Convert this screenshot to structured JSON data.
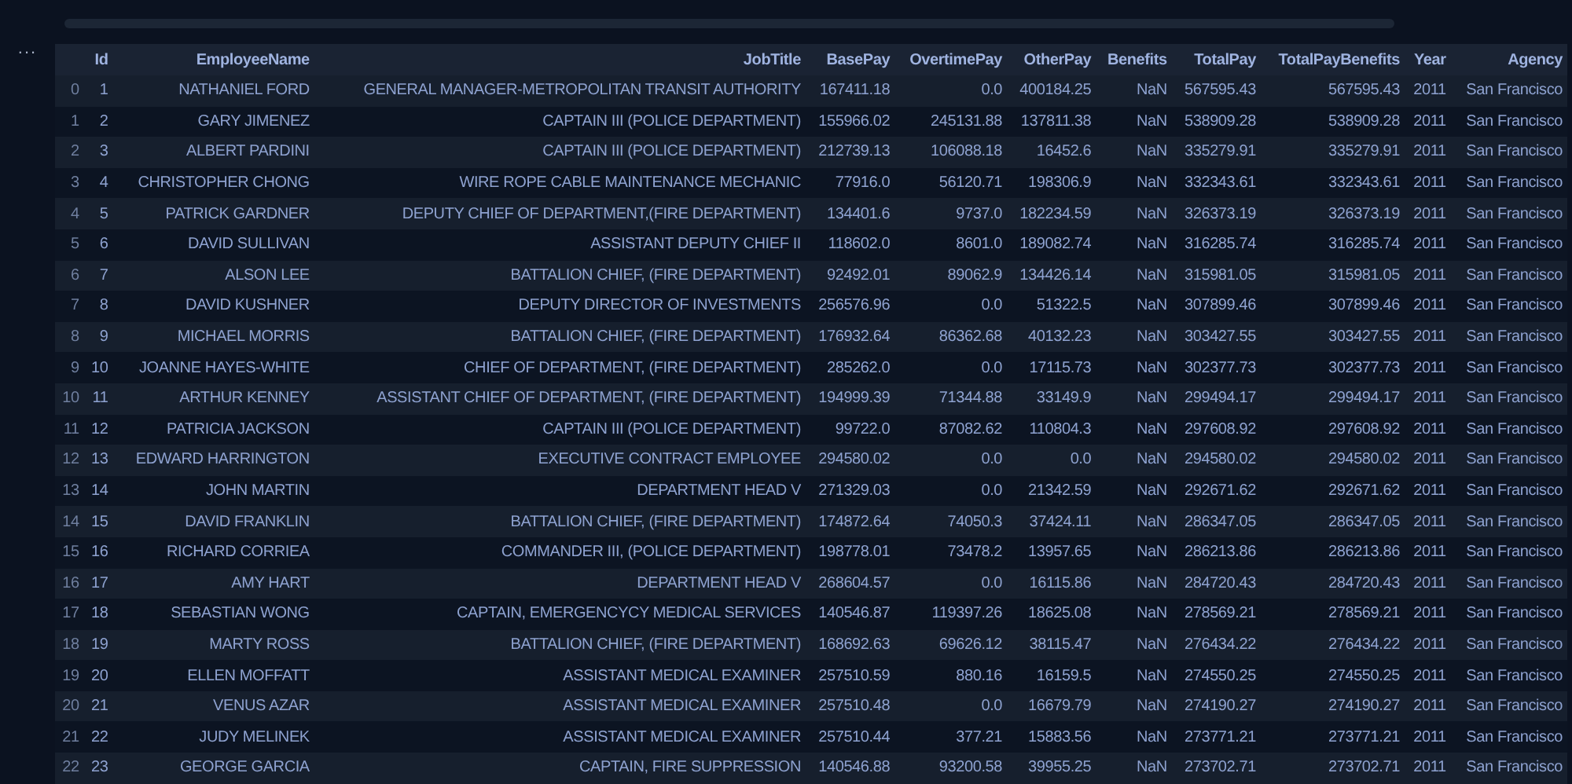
{
  "output_menu": "...",
  "table": {
    "columns": [
      "",
      "Id",
      "EmployeeName",
      "JobTitle",
      "BasePay",
      "OvertimePay",
      "OtherPay",
      "Benefits",
      "TotalPay",
      "TotalPayBenefits",
      "Year",
      "Agency"
    ],
    "rows": [
      [
        "0",
        "1",
        "NATHANIEL FORD",
        "GENERAL MANAGER-METROPOLITAN TRANSIT AUTHORITY",
        "167411.18",
        "0.0",
        "400184.25",
        "NaN",
        "567595.43",
        "567595.43",
        "2011",
        "San Francisco"
      ],
      [
        "1",
        "2",
        "GARY JIMENEZ",
        "CAPTAIN III (POLICE DEPARTMENT)",
        "155966.02",
        "245131.88",
        "137811.38",
        "NaN",
        "538909.28",
        "538909.28",
        "2011",
        "San Francisco"
      ],
      [
        "2",
        "3",
        "ALBERT PARDINI",
        "CAPTAIN III (POLICE DEPARTMENT)",
        "212739.13",
        "106088.18",
        "16452.6",
        "NaN",
        "335279.91",
        "335279.91",
        "2011",
        "San Francisco"
      ],
      [
        "3",
        "4",
        "CHRISTOPHER CHONG",
        "WIRE ROPE CABLE MAINTENANCE MECHANIC",
        "77916.0",
        "56120.71",
        "198306.9",
        "NaN",
        "332343.61",
        "332343.61",
        "2011",
        "San Francisco"
      ],
      [
        "4",
        "5",
        "PATRICK GARDNER",
        "DEPUTY CHIEF OF DEPARTMENT,(FIRE DEPARTMENT)",
        "134401.6",
        "9737.0",
        "182234.59",
        "NaN",
        "326373.19",
        "326373.19",
        "2011",
        "San Francisco"
      ],
      [
        "5",
        "6",
        "DAVID SULLIVAN",
        "ASSISTANT DEPUTY CHIEF II",
        "118602.0",
        "8601.0",
        "189082.74",
        "NaN",
        "316285.74",
        "316285.74",
        "2011",
        "San Francisco"
      ],
      [
        "6",
        "7",
        "ALSON LEE",
        "BATTALION CHIEF, (FIRE DEPARTMENT)",
        "92492.01",
        "89062.9",
        "134426.14",
        "NaN",
        "315981.05",
        "315981.05",
        "2011",
        "San Francisco"
      ],
      [
        "7",
        "8",
        "DAVID KUSHNER",
        "DEPUTY DIRECTOR OF INVESTMENTS",
        "256576.96",
        "0.0",
        "51322.5",
        "NaN",
        "307899.46",
        "307899.46",
        "2011",
        "San Francisco"
      ],
      [
        "8",
        "9",
        "MICHAEL MORRIS",
        "BATTALION CHIEF, (FIRE DEPARTMENT)",
        "176932.64",
        "86362.68",
        "40132.23",
        "NaN",
        "303427.55",
        "303427.55",
        "2011",
        "San Francisco"
      ],
      [
        "9",
        "10",
        "JOANNE HAYES-WHITE",
        "CHIEF OF DEPARTMENT, (FIRE DEPARTMENT)",
        "285262.0",
        "0.0",
        "17115.73",
        "NaN",
        "302377.73",
        "302377.73",
        "2011",
        "San Francisco"
      ],
      [
        "10",
        "11",
        "ARTHUR KENNEY",
        "ASSISTANT CHIEF OF DEPARTMENT, (FIRE DEPARTMENT)",
        "194999.39",
        "71344.88",
        "33149.9",
        "NaN",
        "299494.17",
        "299494.17",
        "2011",
        "San Francisco"
      ],
      [
        "11",
        "12",
        "PATRICIA JACKSON",
        "CAPTAIN III (POLICE DEPARTMENT)",
        "99722.0",
        "87082.62",
        "110804.3",
        "NaN",
        "297608.92",
        "297608.92",
        "2011",
        "San Francisco"
      ],
      [
        "12",
        "13",
        "EDWARD HARRINGTON",
        "EXECUTIVE CONTRACT EMPLOYEE",
        "294580.02",
        "0.0",
        "0.0",
        "NaN",
        "294580.02",
        "294580.02",
        "2011",
        "San Francisco"
      ],
      [
        "13",
        "14",
        "JOHN MARTIN",
        "DEPARTMENT HEAD V",
        "271329.03",
        "0.0",
        "21342.59",
        "NaN",
        "292671.62",
        "292671.62",
        "2011",
        "San Francisco"
      ],
      [
        "14",
        "15",
        "DAVID FRANKLIN",
        "BATTALION CHIEF, (FIRE DEPARTMENT)",
        "174872.64",
        "74050.3",
        "37424.11",
        "NaN",
        "286347.05",
        "286347.05",
        "2011",
        "San Francisco"
      ],
      [
        "15",
        "16",
        "RICHARD CORRIEA",
        "COMMANDER III, (POLICE DEPARTMENT)",
        "198778.01",
        "73478.2",
        "13957.65",
        "NaN",
        "286213.86",
        "286213.86",
        "2011",
        "San Francisco"
      ],
      [
        "16",
        "17",
        "AMY HART",
        "DEPARTMENT HEAD V",
        "268604.57",
        "0.0",
        "16115.86",
        "NaN",
        "284720.43",
        "284720.43",
        "2011",
        "San Francisco"
      ],
      [
        "17",
        "18",
        "SEBASTIAN WONG",
        "CAPTAIN, EMERGENCYCY MEDICAL SERVICES",
        "140546.87",
        "119397.26",
        "18625.08",
        "NaN",
        "278569.21",
        "278569.21",
        "2011",
        "San Francisco"
      ],
      [
        "18",
        "19",
        "MARTY ROSS",
        "BATTALION CHIEF, (FIRE DEPARTMENT)",
        "168692.63",
        "69626.12",
        "38115.47",
        "NaN",
        "276434.22",
        "276434.22",
        "2011",
        "San Francisco"
      ],
      [
        "19",
        "20",
        "ELLEN MOFFATT",
        "ASSISTANT MEDICAL EXAMINER",
        "257510.59",
        "880.16",
        "16159.5",
        "NaN",
        "274550.25",
        "274550.25",
        "2011",
        "San Francisco"
      ],
      [
        "20",
        "21",
        "VENUS AZAR",
        "ASSISTANT MEDICAL EXAMINER",
        "257510.48",
        "0.0",
        "16679.79",
        "NaN",
        "274190.27",
        "274190.27",
        "2011",
        "San Francisco"
      ],
      [
        "21",
        "22",
        "JUDY MELINEK",
        "ASSISTANT MEDICAL EXAMINER",
        "257510.44",
        "377.21",
        "15883.56",
        "NaN",
        "273771.21",
        "273771.21",
        "2011",
        "San Francisco"
      ],
      [
        "22",
        "23",
        "GEORGE GARCIA",
        "CAPTAIN, FIRE SUPPRESSION",
        "140546.88",
        "93200.58",
        "39955.25",
        "NaN",
        "273702.71",
        "273702.71",
        "2011",
        "San Francisco"
      ]
    ]
  }
}
